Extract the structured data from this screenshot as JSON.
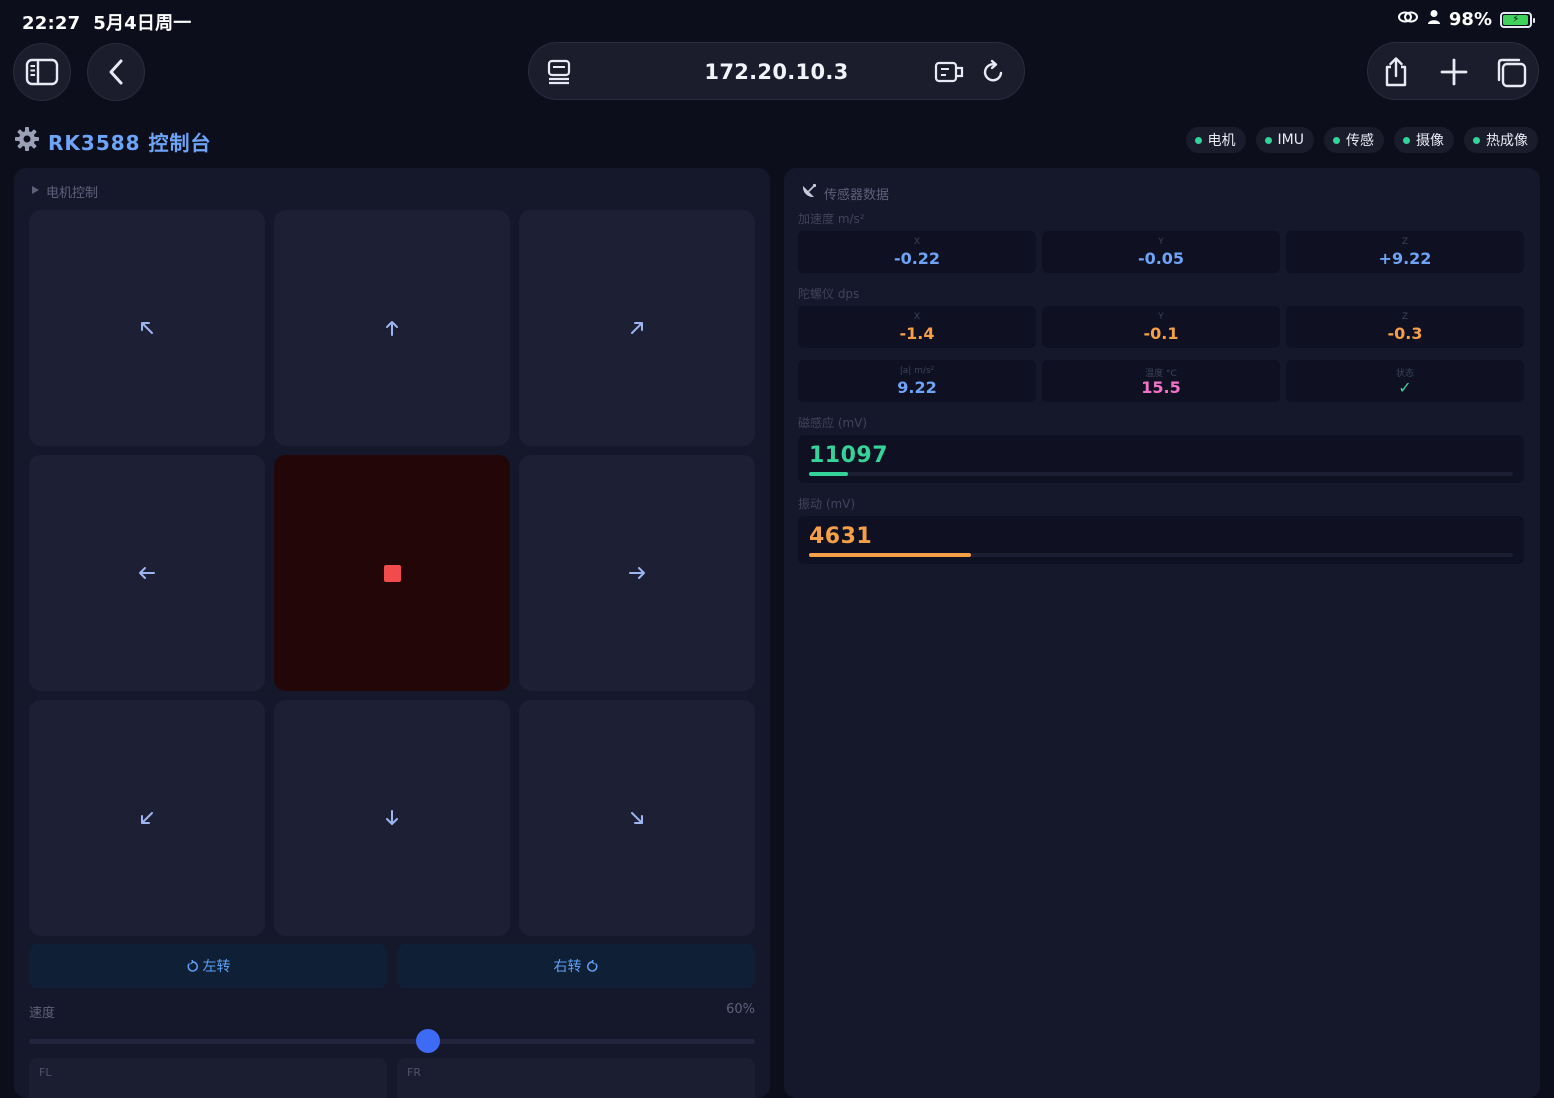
{
  "status_bar": {
    "time": "22:27",
    "date": "5月4日周一",
    "battery": "98%",
    "battery_level": 0.98
  },
  "browser": {
    "url": "172.20.10.3"
  },
  "app": {
    "title": "RK3588 控制台",
    "badges": [
      {
        "label": "电机",
        "status_color": "#34d399"
      },
      {
        "label": "IMU",
        "status_color": "#34d399"
      },
      {
        "label": "传感",
        "status_color": "#34d399"
      },
      {
        "label": "摄像",
        "status_color": "#34d399"
      },
      {
        "label": "热成像",
        "status_color": "#34d399"
      }
    ]
  },
  "motor": {
    "title": "电机控制",
    "rotate_left": "左转",
    "rotate_right": "右转",
    "speed_label": "速度",
    "speed_value": "60%",
    "speed_fraction": 0.55,
    "wheels": [
      "FL",
      "FR"
    ],
    "stop_color": "#f14b4b"
  },
  "sensor": {
    "title": "传感器数据",
    "accel_label": "加速度 m/s²",
    "accel": [
      {
        "axis": "X",
        "value": "-0.22"
      },
      {
        "axis": "Y",
        "value": "-0.05"
      },
      {
        "axis": "Z",
        "value": "+9.22"
      }
    ],
    "gyro_label": "陀螺仪 dps",
    "gyro": [
      {
        "axis": "X",
        "value": "-1.4"
      },
      {
        "axis": "Y",
        "value": "-0.1"
      },
      {
        "axis": "Z",
        "value": "-0.3"
      }
    ],
    "extra": [
      {
        "label": "|a| m/s²",
        "value": "9.22"
      },
      {
        "label": "温度 °C",
        "value": "15.5"
      },
      {
        "label": "状态",
        "value": "✓"
      }
    ],
    "magnetic_label": "磁感应 (mV)",
    "magnetic_value": "11097",
    "magnetic_fraction": 0.055,
    "vibration_label": "振动 (mV)",
    "vibration_value": "4631",
    "vibration_fraction": 0.23
  }
}
